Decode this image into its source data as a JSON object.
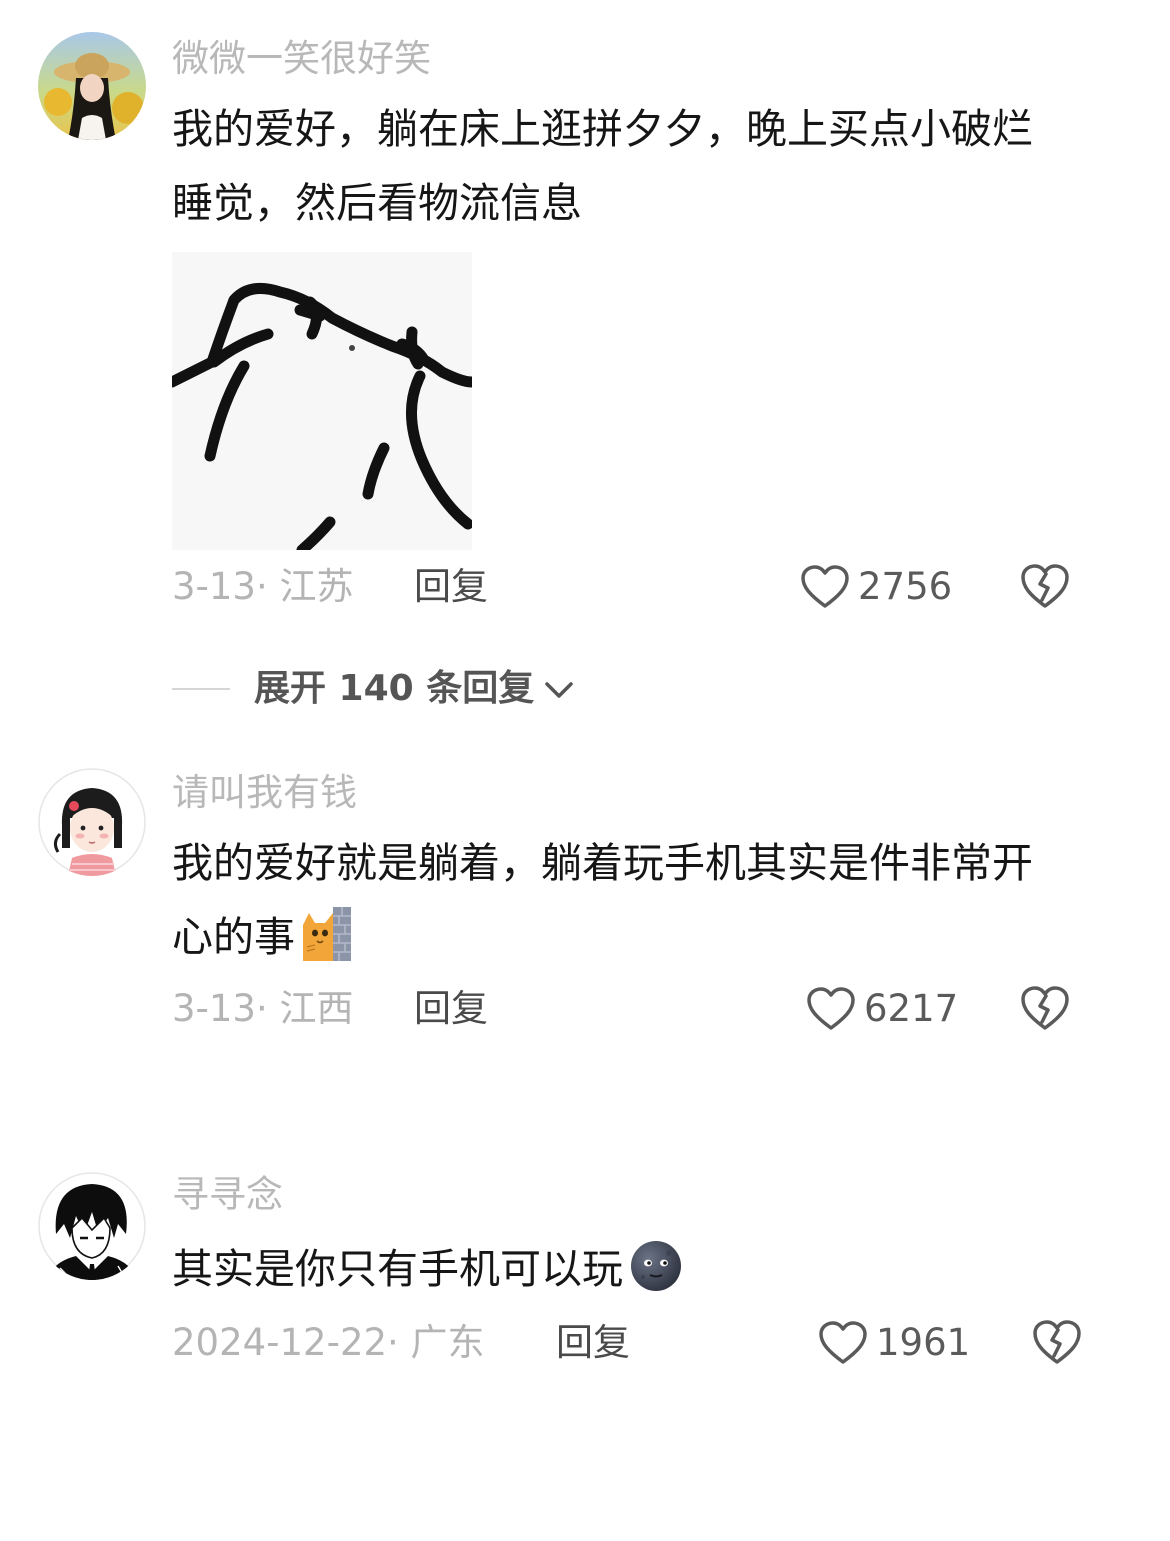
{
  "comments": [
    {
      "username": "微微一笑很好笑",
      "text": "我的爱好，躺在床上逛拼夕夕，晚上买点小破烂睡觉，然后看物流信息",
      "date_location": "3-13· 江苏",
      "reply_label": "回复",
      "likes": "2756",
      "avatar_icon": "woman-straw-hat-avatar",
      "sticker_icon": "cartoon-sketch-sticker"
    },
    {
      "username": "请叫我有钱",
      "text": "我的爱好就是躺着，躺着玩手机其实是件非常开心的事",
      "emoji": "cat-behind-wall-emoji",
      "date_location": "3-13· 江西",
      "reply_label": "回复",
      "likes": "6217",
      "avatar_icon": "cartoon-girl-avatar"
    },
    {
      "username": "寻寻念",
      "text": "其实是你只有手机可以玩",
      "emoji": "dark-moon-face-emoji",
      "date_location": "2024-12-22· 广东",
      "reply_label": "回复",
      "likes": "1961",
      "avatar_icon": "anime-boy-avatar"
    }
  ],
  "expand_replies": {
    "label": "展开 140 条回复"
  },
  "colors": {
    "username": "#b8b8b8",
    "meta": "#b4b4b4",
    "reply": "#4a4a4a",
    "icon": "#5a5a5a"
  }
}
